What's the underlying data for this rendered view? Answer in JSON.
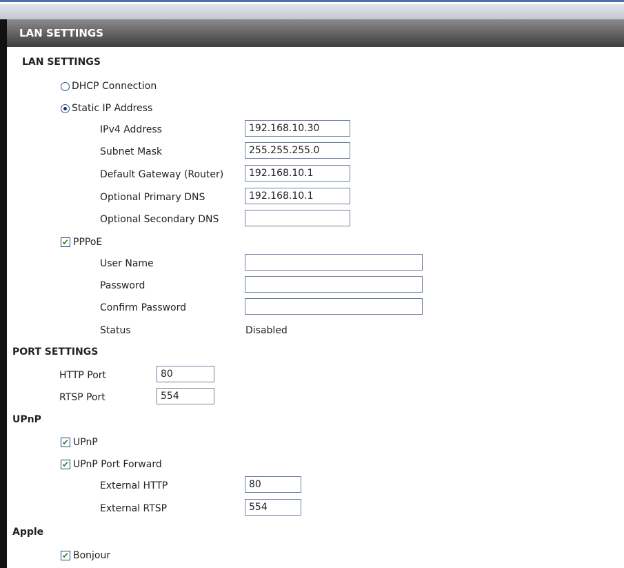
{
  "page_title": "LAN SETTINGS",
  "lan": {
    "section_title": "LAN SETTINGS",
    "dhcp_label": "DHCP Connection",
    "static_label": "Static IP Address",
    "connection_mode": "static",
    "ipv4_label": "IPv4 Address",
    "ipv4_value": "192.168.10.30",
    "subnet_label": "Subnet Mask",
    "subnet_value": "255.255.255.0",
    "gateway_label": "Default Gateway (Router)",
    "gateway_value": "192.168.10.1",
    "primary_dns_label": "Optional Primary DNS",
    "primary_dns_value": "192.168.10.1",
    "secondary_dns_label": "Optional Secondary DNS",
    "secondary_dns_value": ""
  },
  "pppoe": {
    "label": "PPPoE",
    "checked": true,
    "user_label": "User Name",
    "user_value": "",
    "password_label": "Password",
    "password_value": "",
    "confirm_label": "Confirm Password",
    "confirm_value": "",
    "status_label": "Status",
    "status_value": "Disabled"
  },
  "ports": {
    "section_title": "PORT SETTINGS",
    "http_label": "HTTP Port",
    "http_value": "80",
    "rtsp_label": "RTSP Port",
    "rtsp_value": "554"
  },
  "upnp": {
    "section_title": "UPnP",
    "upnp_label": "UPnP",
    "upnp_checked": true,
    "forward_label": "UPnP Port Forward",
    "forward_checked": true,
    "ext_http_label": "External HTTP",
    "ext_http_value": "80",
    "ext_rtsp_label": "External RTSP",
    "ext_rtsp_value": "554"
  },
  "apple": {
    "section_title": "Apple",
    "bonjour_label": "Bonjour",
    "bonjour_checked": true
  }
}
